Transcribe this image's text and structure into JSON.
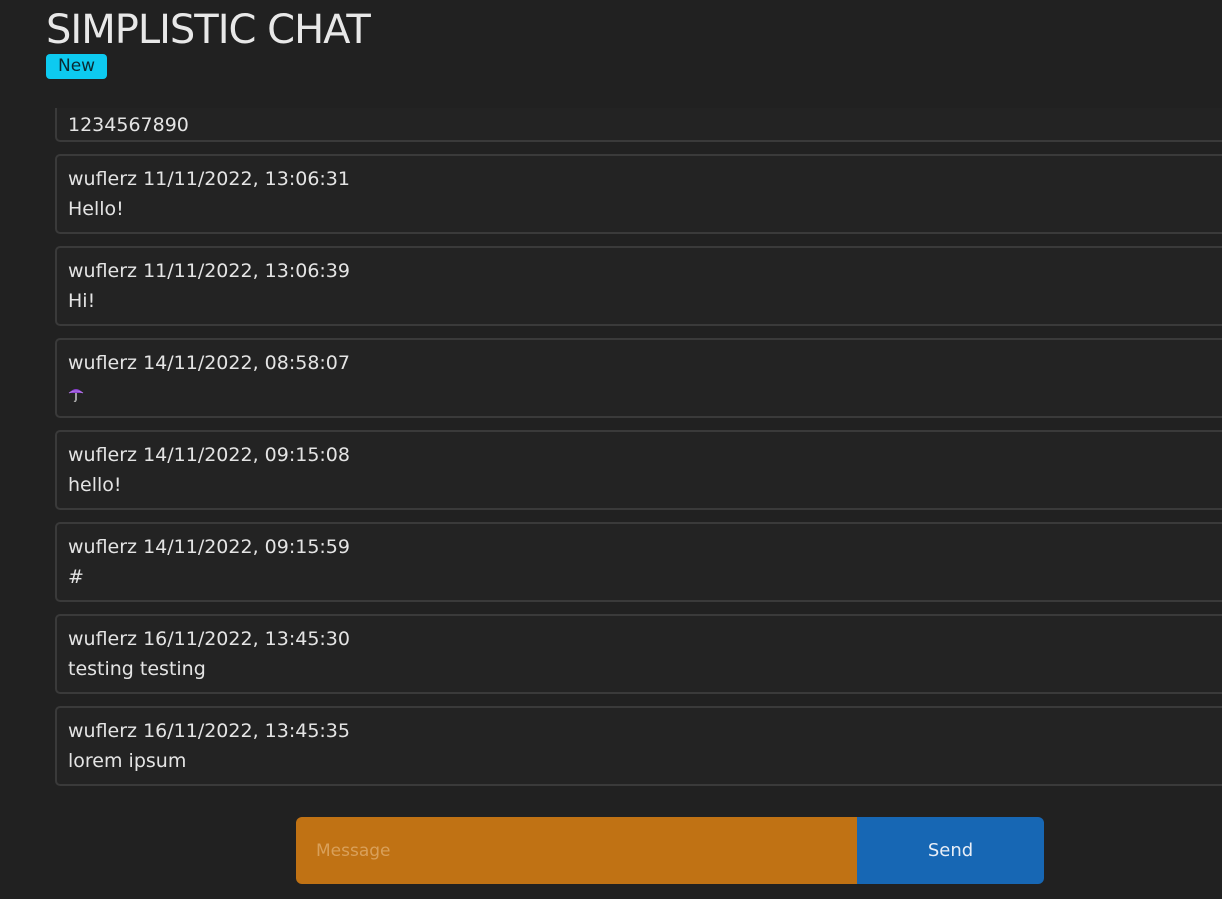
{
  "app": {
    "title": "SIMPLISTIC CHAT",
    "badge": "New"
  },
  "messages": [
    {
      "user": "",
      "timestamp": "",
      "header": "",
      "text": "1234567890"
    },
    {
      "user": "wuflerz",
      "timestamp": "11/11/2022, 13:06:31",
      "header": "wuflerz 11/11/2022, 13:06:31",
      "text": "Hello!"
    },
    {
      "user": "wuflerz",
      "timestamp": "11/11/2022, 13:06:39",
      "header": "wuflerz 11/11/2022, 13:06:39",
      "text": "Hi!"
    },
    {
      "user": "wuflerz",
      "timestamp": "14/11/2022, 08:58:07",
      "header": "wuflerz 14/11/2022, 08:58:07",
      "text": "",
      "icon": "umbrella-emoji-icon"
    },
    {
      "user": "wuflerz",
      "timestamp": "14/11/2022, 09:15:08",
      "header": "wuflerz 14/11/2022, 09:15:08",
      "text": "hello!"
    },
    {
      "user": "wuflerz",
      "timestamp": "14/11/2022, 09:15:59",
      "header": "wuflerz 14/11/2022, 09:15:59",
      "text": "#"
    },
    {
      "user": "wuflerz",
      "timestamp": "16/11/2022, 13:45:30",
      "header": "wuflerz 16/11/2022, 13:45:30",
      "text": "testing testing"
    },
    {
      "user": "wuflerz",
      "timestamp": "16/11/2022, 13:45:35",
      "header": "wuflerz 16/11/2022, 13:45:35",
      "text": "lorem ipsum"
    }
  ],
  "composer": {
    "placeholder": "Message",
    "value": "",
    "send_label": "Send"
  },
  "colors": {
    "background": "#212121",
    "badge": "#0dcaf0",
    "input": "#c07214",
    "send": "#1767b4"
  }
}
